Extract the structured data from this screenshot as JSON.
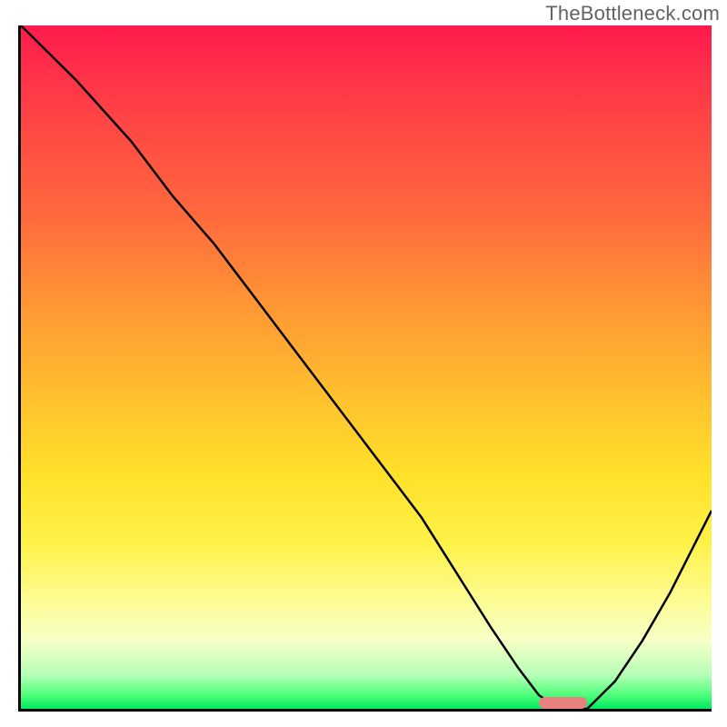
{
  "watermark": "TheBottleneck.com",
  "chart_data": {
    "type": "line",
    "title": "",
    "xlabel": "",
    "ylabel": "",
    "xlim": [
      0,
      100
    ],
    "ylim": [
      0,
      100
    ],
    "x": [
      0,
      8,
      16,
      22,
      28,
      34,
      40,
      46,
      52,
      58,
      63,
      68,
      72,
      75,
      78,
      82,
      86,
      90,
      94,
      98,
      100
    ],
    "values": [
      100,
      92,
      83,
      75,
      68,
      60,
      52,
      44,
      36,
      28,
      20,
      12,
      6,
      2,
      0,
      0,
      4,
      10,
      17,
      25,
      29
    ],
    "grid": false,
    "annotations": [
      {
        "type": "marker",
        "shape": "rounded-rect",
        "x_start": 75,
        "x_end": 82,
        "y": 0,
        "color": "#e98080"
      }
    ]
  },
  "colors": {
    "axis": "#000000",
    "curve": "#000000",
    "marker": "#e98080",
    "watermark": "#636363"
  }
}
